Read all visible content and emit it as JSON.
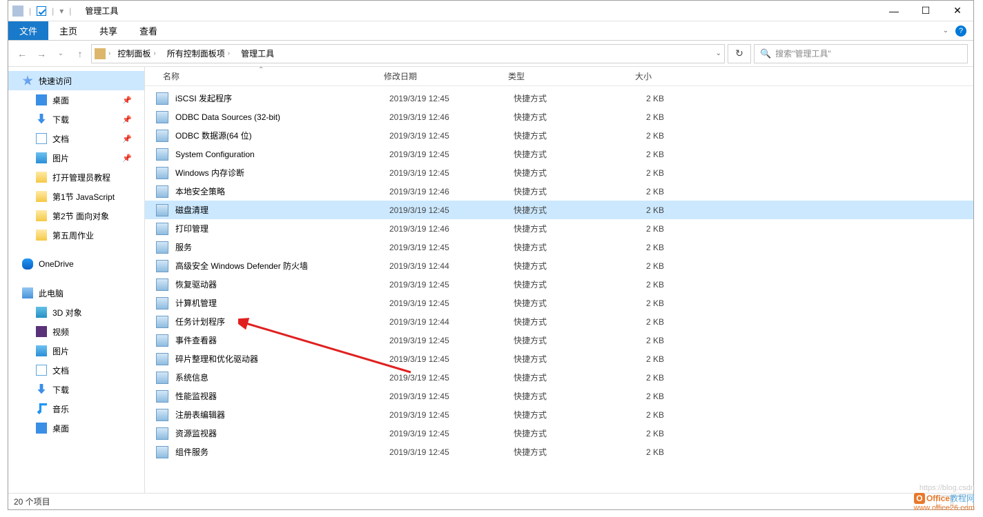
{
  "window": {
    "title": "管理工具"
  },
  "ribbon": {
    "file": "文件",
    "tabs": [
      "主页",
      "共享",
      "查看"
    ]
  },
  "breadcrumb": [
    "控制面板",
    "所有控制面板项",
    "管理工具"
  ],
  "search": {
    "placeholder": "搜索\"管理工具\""
  },
  "columns": {
    "name": "名称",
    "date": "修改日期",
    "type": "类型",
    "size": "大小"
  },
  "sidebar": [
    {
      "label": "快速访问",
      "icon": "star",
      "selected": true
    },
    {
      "label": "桌面",
      "icon": "desktop",
      "sub": true,
      "pinned": true
    },
    {
      "label": "下载",
      "icon": "downloads",
      "sub": true,
      "pinned": true
    },
    {
      "label": "文档",
      "icon": "document",
      "sub": true,
      "pinned": true
    },
    {
      "label": "图片",
      "icon": "pictures",
      "sub": true,
      "pinned": true
    },
    {
      "label": "打开管理员教程",
      "icon": "folder",
      "sub": true
    },
    {
      "label": "第1节 JavaScript",
      "icon": "folder",
      "sub": true
    },
    {
      "label": "第2节 面向对象",
      "icon": "folder",
      "sub": true
    },
    {
      "label": "第五周作业",
      "icon": "folder",
      "sub": true
    },
    {
      "label": "OneDrive",
      "icon": "onedrive",
      "spaced": true
    },
    {
      "label": "此电脑",
      "icon": "pc",
      "spaced": true
    },
    {
      "label": "3D 对象",
      "icon": "cube",
      "sub": true
    },
    {
      "label": "视频",
      "icon": "video",
      "sub": true
    },
    {
      "label": "图片",
      "icon": "pictures",
      "sub": true
    },
    {
      "label": "文档",
      "icon": "document",
      "sub": true
    },
    {
      "label": "下载",
      "icon": "downloads",
      "sub": true
    },
    {
      "label": "音乐",
      "icon": "music",
      "sub": true
    },
    {
      "label": "桌面",
      "icon": "desktop",
      "sub": true
    }
  ],
  "files": [
    {
      "name": "iSCSI 发起程序",
      "date": "2019/3/19 12:45",
      "type": "快捷方式",
      "size": "2 KB"
    },
    {
      "name": "ODBC Data Sources (32-bit)",
      "date": "2019/3/19 12:46",
      "type": "快捷方式",
      "size": "2 KB"
    },
    {
      "name": "ODBC 数据源(64 位)",
      "date": "2019/3/19 12:45",
      "type": "快捷方式",
      "size": "2 KB"
    },
    {
      "name": "System Configuration",
      "date": "2019/3/19 12:45",
      "type": "快捷方式",
      "size": "2 KB"
    },
    {
      "name": "Windows 内存诊断",
      "date": "2019/3/19 12:45",
      "type": "快捷方式",
      "size": "2 KB"
    },
    {
      "name": "本地安全策略",
      "date": "2019/3/19 12:46",
      "type": "快捷方式",
      "size": "2 KB"
    },
    {
      "name": "磁盘清理",
      "date": "2019/3/19 12:45",
      "type": "快捷方式",
      "size": "2 KB",
      "selected": true
    },
    {
      "name": "打印管理",
      "date": "2019/3/19 12:46",
      "type": "快捷方式",
      "size": "2 KB"
    },
    {
      "name": "服务",
      "date": "2019/3/19 12:45",
      "type": "快捷方式",
      "size": "2 KB"
    },
    {
      "name": "高级安全 Windows Defender 防火墙",
      "date": "2019/3/19 12:44",
      "type": "快捷方式",
      "size": "2 KB"
    },
    {
      "name": "恢复驱动器",
      "date": "2019/3/19 12:45",
      "type": "快捷方式",
      "size": "2 KB"
    },
    {
      "name": "计算机管理",
      "date": "2019/3/19 12:45",
      "type": "快捷方式",
      "size": "2 KB"
    },
    {
      "name": "任务计划程序",
      "date": "2019/3/19 12:44",
      "type": "快捷方式",
      "size": "2 KB"
    },
    {
      "name": "事件查看器",
      "date": "2019/3/19 12:45",
      "type": "快捷方式",
      "size": "2 KB"
    },
    {
      "name": "碎片整理和优化驱动器",
      "date": "2019/3/19 12:45",
      "type": "快捷方式",
      "size": "2 KB"
    },
    {
      "name": "系统信息",
      "date": "2019/3/19 12:45",
      "type": "快捷方式",
      "size": "2 KB"
    },
    {
      "name": "性能监视器",
      "date": "2019/3/19 12:45",
      "type": "快捷方式",
      "size": "2 KB"
    },
    {
      "name": "注册表编辑器",
      "date": "2019/3/19 12:45",
      "type": "快捷方式",
      "size": "2 KB"
    },
    {
      "name": "资源监视器",
      "date": "2019/3/19 12:45",
      "type": "快捷方式",
      "size": "2 KB"
    },
    {
      "name": "组件服务",
      "date": "2019/3/19 12:45",
      "type": "快捷方式",
      "size": "2 KB"
    }
  ],
  "status": {
    "count": "20 个项目"
  },
  "watermark": {
    "line1a": "Office",
    "line1b": "教程网",
    "line2": "www.office26.com",
    "csdn": "https://blog.csdn"
  }
}
